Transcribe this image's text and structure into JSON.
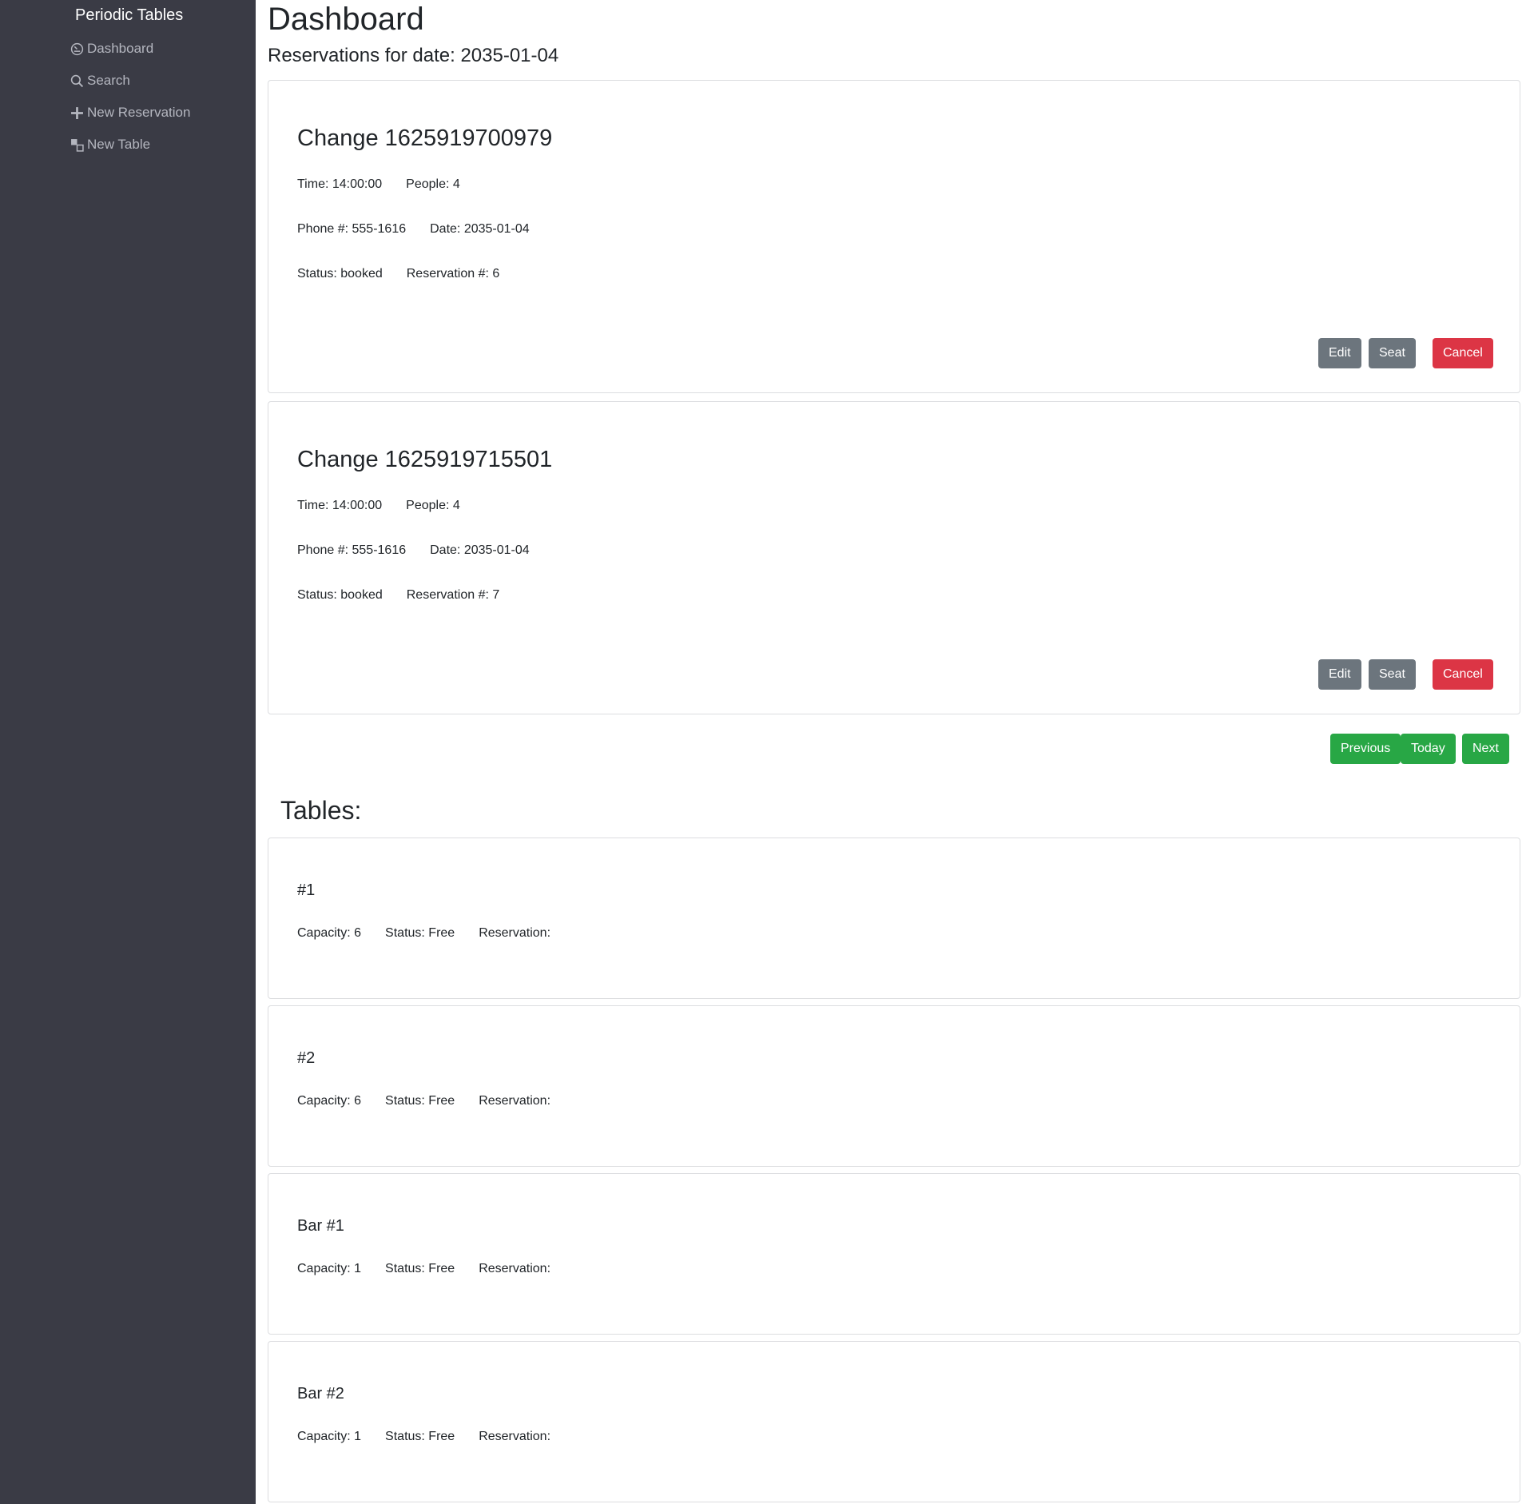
{
  "sidebar": {
    "brand": "Periodic Tables",
    "items": [
      {
        "label": "Dashboard",
        "icon": "dashboard-icon"
      },
      {
        "label": "Search",
        "icon": "search-icon"
      },
      {
        "label": "New Reservation",
        "icon": "plus-icon"
      },
      {
        "label": "New Table",
        "icon": "layers-icon"
      }
    ]
  },
  "header": {
    "title": "Dashboard",
    "subtitle": "Reservations for date: 2035-01-04"
  },
  "reservations": [
    {
      "title": "Change 1625919700979",
      "time": "Time: 14:00:00",
      "people": "People: 4",
      "phone": "Phone #: 555-1616",
      "date": "Date: 2035-01-04",
      "status": "Status: booked",
      "reservation_id": "Reservation #: 6",
      "edit_label": "Edit",
      "seat_label": "Seat",
      "cancel_label": "Cancel"
    },
    {
      "title": "Change 1625919715501",
      "time": "Time: 14:00:00",
      "people": "People: 4",
      "phone": "Phone #: 555-1616",
      "date": "Date: 2035-01-04",
      "status": "Status: booked",
      "reservation_id": "Reservation #: 7",
      "edit_label": "Edit",
      "seat_label": "Seat",
      "cancel_label": "Cancel"
    }
  ],
  "date_nav": {
    "previous_label": "Previous",
    "today_label": "Today",
    "next_label": "Next"
  },
  "tables_heading": "Tables:",
  "tables": [
    {
      "name": "#1",
      "capacity": "Capacity: 6",
      "status": "Status: Free",
      "reservation": "Reservation:"
    },
    {
      "name": "#2",
      "capacity": "Capacity: 6",
      "status": "Status: Free",
      "reservation": "Reservation:"
    },
    {
      "name": "Bar #1",
      "capacity": "Capacity: 1",
      "status": "Status: Free",
      "reservation": "Reservation:"
    },
    {
      "name": "Bar #2",
      "capacity": "Capacity: 1",
      "status": "Status: Free",
      "reservation": "Reservation:"
    }
  ],
  "colors": {
    "sidebar_bg": "#3a3b45",
    "secondary_button": "#6c757d",
    "danger_button": "#dc3545",
    "success_button": "#28a745"
  }
}
